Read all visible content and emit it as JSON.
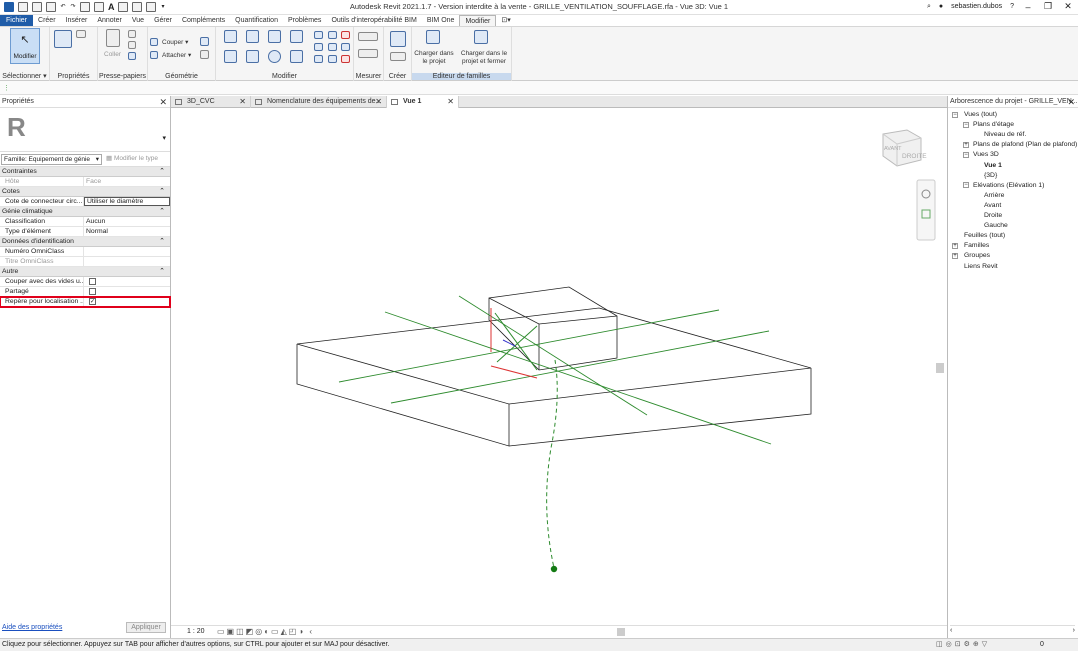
{
  "titlebar": {
    "title": "Autodesk Revit 2021.1.7 - Version interdite à la vente - GRILLE_VENTILATION_SOUFFLAGE.rfa - Vue 3D: Vue 1",
    "user": "sebastien.dubos",
    "help": "?"
  },
  "menu": [
    "Fichier",
    "Créer",
    "Insérer",
    "Annoter",
    "Vue",
    "Gérer",
    "Compléments",
    "Quantification",
    "Problèmes",
    "Outils d'interopérabilité BIM",
    "BIM One",
    "Modifier"
  ],
  "ribbon": {
    "select": {
      "button": "Modifier",
      "label": "Sélectionner"
    },
    "properties": {
      "label": "Propriétés"
    },
    "clipboard": {
      "paste": "Coller",
      "label": "Presse-papiers"
    },
    "geometry": {
      "cut": "Couper",
      "attach": "Attacher",
      "label": "Géométrie"
    },
    "modify": {
      "label": "Modifier"
    },
    "measure": {
      "label": "Mesurer"
    },
    "create": {
      "label": "Créer"
    },
    "family_editor": {
      "load": "Charger dans le projet",
      "load_close": "Charger dans le projet et fermer",
      "label": "Editeur de familles"
    }
  },
  "properties": {
    "header": "Propriétés",
    "family_select": "Famille: Equipement de génie",
    "edit_type": "Modifier le type",
    "categories": [
      {
        "name": "Contraintes",
        "rows": [
          {
            "key": "Hôte",
            "value": "Face",
            "dim": true
          }
        ]
      },
      {
        "name": "Cotes",
        "rows": [
          {
            "key": "Cote de connecteur circ...",
            "value": "Utiliser le diamètre",
            "input": true
          }
        ]
      },
      {
        "name": "Génie climatique",
        "rows": [
          {
            "key": "Classification",
            "value": "Aucun"
          },
          {
            "key": "Type d'élément",
            "value": "Normal"
          }
        ]
      },
      {
        "name": "Données d'identification",
        "rows": [
          {
            "key": "Numéro OmniClass",
            "value": ""
          },
          {
            "key": "Titre OmniClass",
            "value": "",
            "dim": true
          }
        ]
      },
      {
        "name": "Autre",
        "rows": [
          {
            "key": "Couper avec des vides u...",
            "check": ""
          },
          {
            "key": "Partagé",
            "check": ""
          },
          {
            "key": "Repère pour localisation ...",
            "check": "✓",
            "highlight": true
          }
        ]
      }
    ],
    "help_link": "Aide des propriétés",
    "apply": "Appliquer"
  },
  "view_tabs": [
    {
      "label": "3D_CVC",
      "active": false
    },
    {
      "label": "Nomenclature des équipements de...",
      "active": false
    },
    {
      "label": "Vue 1",
      "active": true
    }
  ],
  "view": {
    "scale": "1 : 20",
    "viewcube_face": "DROITE",
    "viewcube_side": "AVANT"
  },
  "browser": {
    "header": "Arborescence du projet - GRILLE_VEN...",
    "items": [
      {
        "label": "Vues (tout)",
        "level": 0,
        "exp": "−"
      },
      {
        "label": "Plans d'étage",
        "level": 1,
        "exp": "−"
      },
      {
        "label": "Niveau de réf.",
        "level": 2
      },
      {
        "label": "Plans de plafond (Plan de plafond)",
        "level": 1,
        "exp": "+"
      },
      {
        "label": "Vues 3D",
        "level": 1,
        "exp": "−"
      },
      {
        "label": "Vue 1",
        "level": 2,
        "bold": true
      },
      {
        "label": "{3D}",
        "level": 2
      },
      {
        "label": "Elévations (Elévation 1)",
        "level": 1,
        "exp": "−"
      },
      {
        "label": "Arrière",
        "level": 2
      },
      {
        "label": "Avant",
        "level": 2
      },
      {
        "label": "Droite",
        "level": 2
      },
      {
        "label": "Gauche",
        "level": 2
      },
      {
        "label": "Feuilles (tout)",
        "level": 0
      },
      {
        "label": "Familles",
        "level": 0,
        "exp": "+"
      },
      {
        "label": "Groupes",
        "level": 0,
        "exp": "+"
      },
      {
        "label": "Liens Revit",
        "level": 0
      }
    ]
  },
  "status": {
    "text": "Cliquez pour sélectionner. Appuyez sur TAB pour afficher d'autres options, sur CTRL pour ajouter et sur MAJ pour désactiver.",
    "filter_count": "0"
  },
  "colors": {
    "file_tab": "#1f5ca8",
    "highlight_box": "#e0001b",
    "ref_line": "#2e8b2e"
  }
}
